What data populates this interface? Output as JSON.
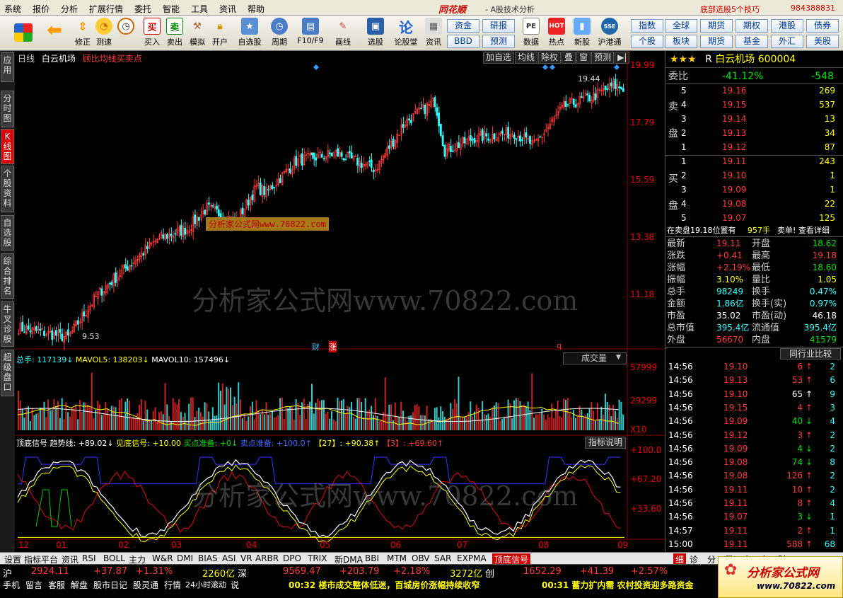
{
  "menu": {
    "items": [
      "系统",
      "报价",
      "分析",
      "扩展行情",
      "委托",
      "智能",
      "工具",
      "资讯",
      "帮助"
    ],
    "brand": "同花顺",
    "brand_sub": "- A股技术分析",
    "promo": "底部选股5个技巧",
    "promo_num": "984388831"
  },
  "toolbar": {
    "buttons": [
      "修正",
      "测速",
      "买入",
      "卖出",
      "模拟",
      "开户",
      "自选股",
      "周期",
      "F10/F9",
      "画线",
      "选股",
      "论股堂",
      "资讯",
      "数据",
      "热点",
      "新股",
      "沪港通"
    ],
    "quick": [
      "资金",
      "研报",
      "指数",
      "全球",
      "期货",
      "港股",
      "债券",
      "BBD",
      "预测",
      "个股",
      "板块",
      "基金",
      "外汇",
      "美股"
    ],
    "quick_top_right": [
      "期权"
    ]
  },
  "left_tabs": [
    "应用",
    "分时图",
    "K线图",
    "个股资料",
    "自选股",
    "综合排名",
    "牛叉诊股",
    "超级盘口"
  ],
  "chart": {
    "header_period": "日线",
    "header_stock": "白云机场",
    "header_formula": "顾比均线买卖点",
    "top_buttons": [
      "加自选",
      "均线",
      "除权",
      "叠",
      "窗",
      "预测"
    ],
    "price_axis": [
      "19.99",
      "17.79",
      "15.59",
      "13.38",
      "11.18"
    ],
    "high_label": "19.44",
    "low_label": "9.53",
    "volume": {
      "label": "总手: 117139↓",
      "mavol5": "MAVOL5: 138203↓",
      "mavol10": "MAVOL10: 157496↓",
      "axis": [
        "57999",
        "29299",
        "X10"
      ],
      "dropdown": "成交量"
    },
    "indicator": {
      "name": "顶底信号",
      "trend": "趋势线: +89.02↓",
      "bottom": "见底信号: +10.00",
      "buy_ready": "买点准备: +0↓",
      "sell_ready": "卖点准备: +100.0↑",
      "v27": "【27】: +90.38↑",
      "v3": "【3】: +69.60↑",
      "axis": [
        "+100.0",
        "+67.20",
        "+33.60"
      ],
      "button": "指标说明"
    },
    "months": [
      "12",
      "01",
      "02",
      "03",
      "04",
      "05",
      "06",
      "07",
      "08",
      "09"
    ],
    "markers": [
      "财",
      "涨",
      "q"
    ],
    "watermark": "分析家公式网www.70822.com",
    "watermark_box": "分析家公式网www.70822.com"
  },
  "quote": {
    "title_name": "白云机场",
    "title_code": "600004",
    "title_prefix": "R",
    "wb_label": "委比",
    "wb_pct": "-41.12%",
    "wb_val": "-548",
    "sell": [
      {
        "n": "5",
        "p": "19.16",
        "v": "269"
      },
      {
        "n": "4",
        "p": "19.15",
        "v": "537"
      },
      {
        "n": "3",
        "p": "19.14",
        "v": "13"
      },
      {
        "n": "2",
        "p": "19.13",
        "v": "34"
      },
      {
        "n": "1",
        "p": "19.12",
        "v": "87"
      }
    ],
    "buy": [
      {
        "n": "1",
        "p": "19.11",
        "v": "243"
      },
      {
        "n": "2",
        "p": "19.10",
        "v": "1"
      },
      {
        "n": "3",
        "p": "19.09",
        "v": "1"
      },
      {
        "n": "4",
        "p": "19.08",
        "v": "22"
      },
      {
        "n": "5",
        "p": "19.07",
        "v": "125"
      }
    ],
    "sell_side": "卖盘",
    "buy_side": "买盘",
    "notice": "在卖盘19.18位置有",
    "notice_v": "957手",
    "notice_tail": "卖单! 查看详细",
    "stats": [
      {
        "l1": "最新",
        "v1": "19.11",
        "l2": "开盘",
        "v2": "18.62",
        "c1": "red",
        "c2": "green"
      },
      {
        "l1": "涨跌",
        "v1": "+0.41",
        "l2": "最高",
        "v2": "19.18",
        "c1": "red",
        "c2": "red"
      },
      {
        "l1": "涨幅",
        "v1": "+2.19%",
        "l2": "最低",
        "v2": "18.60",
        "c1": "red",
        "c2": "green"
      },
      {
        "l1": "振幅",
        "v1": "3.10%",
        "l2": "量比",
        "v2": "1.05",
        "c1": "yellow",
        "c2": "yellow"
      },
      {
        "l1": "总手",
        "v1": "98249",
        "l2": "换手",
        "v2": "0.47%",
        "c1": "cyan",
        "c2": "cyan"
      },
      {
        "l1": "金额",
        "v1": "1.86亿",
        "l2": "换手(实)",
        "v2": "0.97%",
        "c1": "cyan",
        "c2": "cyan"
      },
      {
        "l1": "市盈",
        "v1": "35.02",
        "l2": "市盈(动)",
        "v2": "46.18",
        "c1": "white",
        "c2": "white"
      },
      {
        "l1": "总市值",
        "v1": "395.4亿",
        "l2": "流通值",
        "v2": "395.4亿",
        "c1": "cyan",
        "c2": "cyan"
      },
      {
        "l1": "外盘",
        "v1": "56670",
        "l2": "内盘",
        "v2": "41579",
        "c1": "red",
        "c2": "green"
      }
    ],
    "compare_btn": "同行业比较",
    "ticks": [
      {
        "t": "14:56",
        "p": "19.10",
        "v": "6",
        "a": "up",
        "n": "2",
        "pc": "red",
        "vc": "red"
      },
      {
        "t": "14:56",
        "p": "19.13",
        "v": "53",
        "a": "up",
        "n": "6",
        "pc": "red",
        "vc": "red"
      },
      {
        "t": "14:56",
        "p": "19.10",
        "v": "65",
        "a": "up",
        "n": "9",
        "pc": "red",
        "vc": "white"
      },
      {
        "t": "14:56",
        "p": "19.15",
        "v": "4",
        "a": "up",
        "n": "3",
        "pc": "red",
        "vc": "red"
      },
      {
        "t": "14:56",
        "p": "19.09",
        "v": "40",
        "a": "down",
        "n": "4",
        "pc": "red",
        "vc": "green"
      },
      {
        "t": "14:56",
        "p": "19.12",
        "v": "3",
        "a": "up",
        "n": "2",
        "pc": "red",
        "vc": "red"
      },
      {
        "t": "14:56",
        "p": "19.09",
        "v": "4",
        "a": "down",
        "n": "2",
        "pc": "red",
        "vc": "green"
      },
      {
        "t": "14:56",
        "p": "19.08",
        "v": "74",
        "a": "down",
        "n": "8",
        "pc": "red",
        "vc": "green"
      },
      {
        "t": "14:56",
        "p": "19.08",
        "v": "126",
        "a": "up",
        "n": "2",
        "pc": "red",
        "vc": "red"
      },
      {
        "t": "14:56",
        "p": "19.11",
        "v": "10",
        "a": "up",
        "n": "2",
        "pc": "red",
        "vc": "red"
      },
      {
        "t": "14:56",
        "p": "19.11",
        "v": "8",
        "a": "up",
        "n": "4",
        "pc": "red",
        "vc": "red"
      },
      {
        "t": "14:56",
        "p": "19.07",
        "v": "3",
        "a": "down",
        "n": "1",
        "pc": "red",
        "vc": "green"
      },
      {
        "t": "14:57",
        "p": "19.11",
        "v": "2",
        "a": "up",
        "n": "1",
        "pc": "red",
        "vc": "red"
      },
      {
        "t": "15:00",
        "p": "19.11",
        "v": "588",
        "a": "up",
        "n": "68",
        "pc": "red",
        "vc": "red"
      }
    ],
    "bottom_tabs": [
      "细",
      "诊",
      "分",
      "量",
      "仓",
      "主",
      "财"
    ]
  },
  "sheet_tabs": [
    "设置",
    "指标平台",
    "资讯",
    "RSI",
    "BOLL",
    "主力",
    "W&R",
    "DMI",
    "BIAS",
    "ASI",
    "VR",
    "ARBR",
    "DPO",
    "TRIX",
    "新DMA",
    "BBI",
    "MTM",
    "OBV",
    "SAR",
    "EXPMA",
    "顶底信号"
  ],
  "status": {
    "sh": "沪",
    "sh_val": "2924.11",
    "sh_chg": "+37.87",
    "sh_pct": "+1.31%",
    "sh_amt": "2260亿",
    "sz": "深",
    "sz_val": "9569.47",
    "sz_chg": "+203.79",
    "sz_pct": "+2.18%",
    "sz_amt": "3272亿",
    "cy": "创",
    "cy_val": "1652.29",
    "cy_chg": "+41.39",
    "cy_pct": "+2.57%"
  },
  "bottom": {
    "items": [
      "手机",
      "留言",
      "客服",
      "解盘",
      "股市日记",
      "股灵通",
      "行情",
      "24小时滚动",
      "说"
    ],
    "news1": "00:32 楼市成交整体低迷，百城房价涨幅持续收窄",
    "news2": "00:31 蓄力扩内需 农村投资迎多路资金"
  },
  "logo": {
    "text": "分析家公式网",
    "url": "www.70822.com"
  },
  "colors": {
    "up": "#ff3a3a",
    "down": "#3ff",
    "accent": "#c00"
  }
}
